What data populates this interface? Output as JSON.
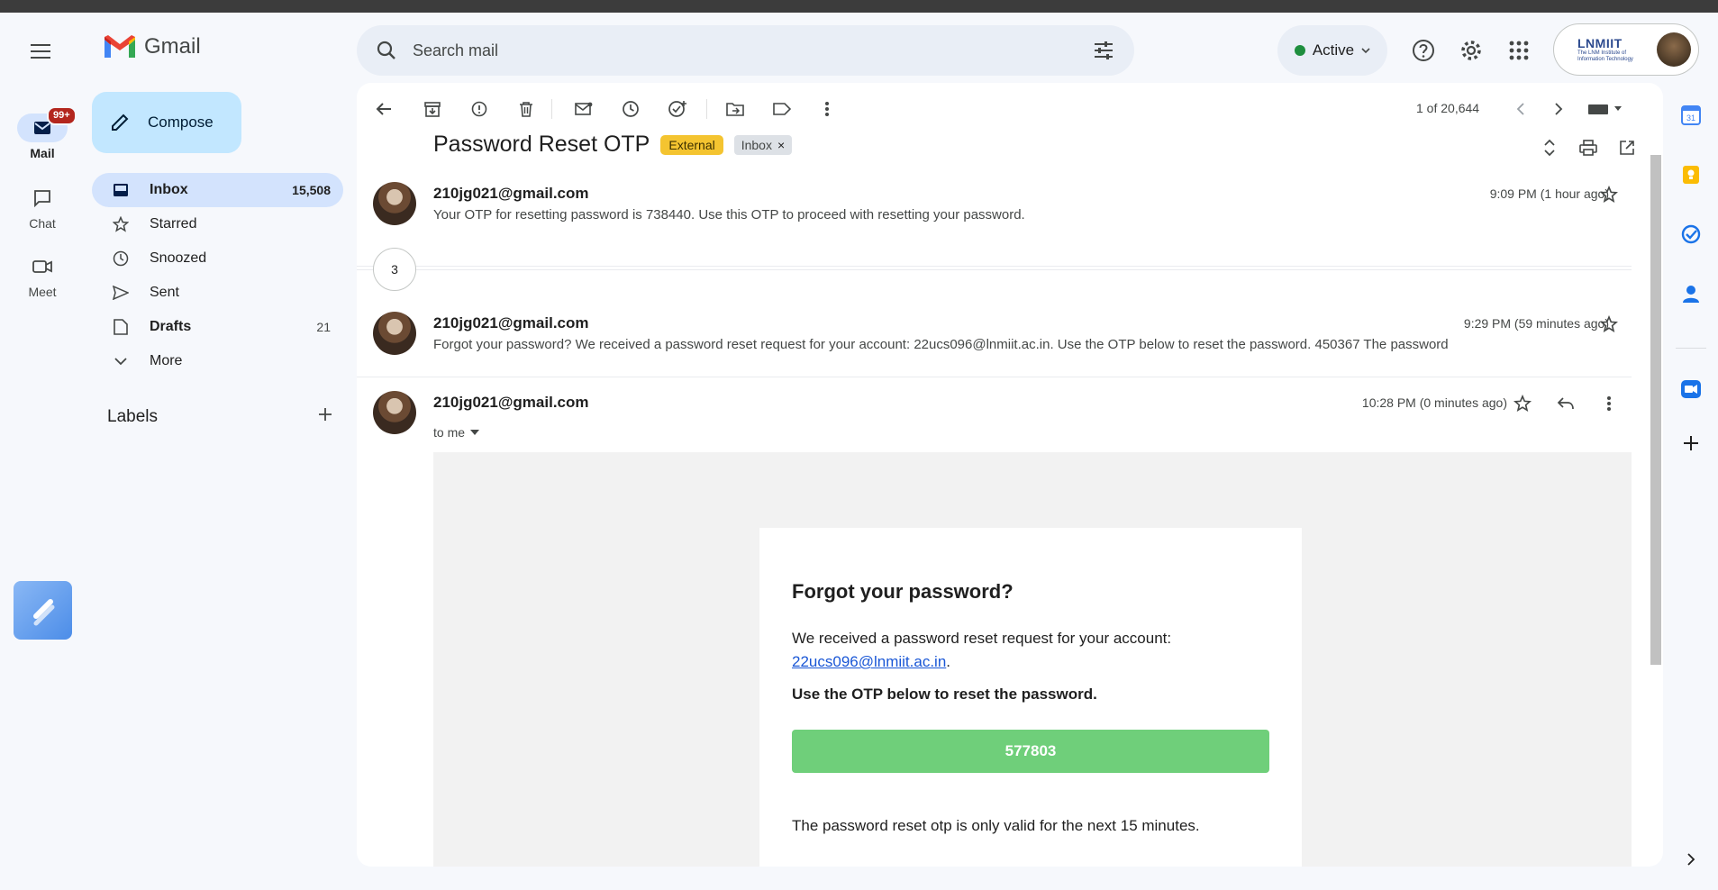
{
  "app": {
    "name": "Gmail",
    "search_placeholder": "Search mail",
    "status": "Active",
    "org_name": "LNMIIT",
    "org_subtitle": "The LNM Institute of Information Technology"
  },
  "rail": {
    "mail_label": "Mail",
    "mail_badge": "99+",
    "chat_label": "Chat",
    "meet_label": "Meet"
  },
  "sidebar": {
    "compose_label": "Compose",
    "items": [
      {
        "label": "Inbox",
        "count": "15,508",
        "icon": "inbox-icon"
      },
      {
        "label": "Starred",
        "count": "",
        "icon": "star-icon"
      },
      {
        "label": "Snoozed",
        "count": "",
        "icon": "clock-icon"
      },
      {
        "label": "Sent",
        "count": "",
        "icon": "send-icon"
      },
      {
        "label": "Drafts",
        "count": "21",
        "icon": "draft-icon"
      },
      {
        "label": "More",
        "count": "",
        "icon": "chevron-down-icon"
      }
    ],
    "labels_title": "Labels"
  },
  "toolbar": {
    "pager": "1 of 20,644"
  },
  "thread": {
    "subject": "Password Reset OTP",
    "tag_external": "External",
    "tag_inbox": "Inbox",
    "collapsed_count": "3",
    "messages": [
      {
        "sender": "210jg021@gmail.com",
        "time": "9:09 PM (1 hour ago)",
        "snippet": "Your OTP for resetting password is 738440. Use this OTP to proceed with resetting your password."
      },
      {
        "sender": "210jg021@gmail.com",
        "time": "9:29 PM (59 minutes ago)",
        "snippet": "Forgot your password? We received a password reset request for your account: 22ucs096@lnmiit.ac.in. Use the OTP below to reset the password. 450367 The password"
      },
      {
        "sender": "210jg021@gmail.com",
        "time": "10:28 PM (0 minutes ago)",
        "to": "to me"
      }
    ]
  },
  "email": {
    "heading": "Forgot your password?",
    "intro": "We received a password reset request for your account:",
    "account_link": "22ucs096@lnmiit.ac.in",
    "period": ".",
    "instruction": "Use the OTP below to reset the password.",
    "otp": "577803",
    "validity": "The password reset otp is only valid for the next 15 minutes."
  },
  "colors": {
    "accent": "#c2e7ff",
    "nav_active": "#d3e3fd",
    "badge": "#b3261e",
    "external_tag": "#f4c430",
    "otp_button": "#6fcf7a",
    "status_dot": "#1e8e3e"
  }
}
